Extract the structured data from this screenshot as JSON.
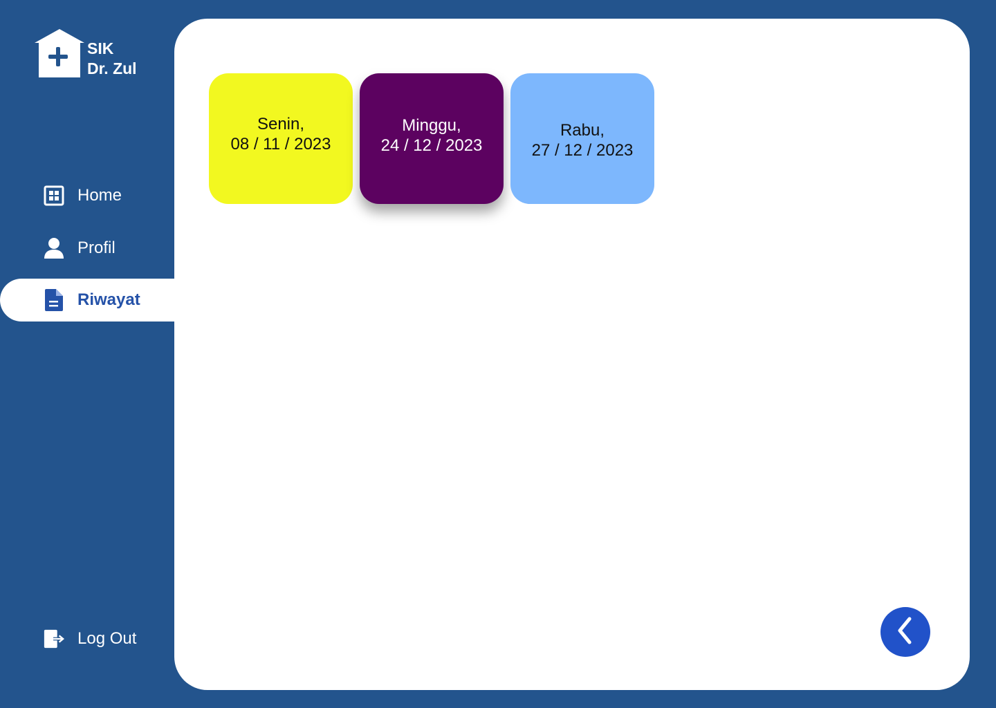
{
  "brand": {
    "line1": "SIK",
    "line2": "Dr. Zul",
    "logo_icon": "medical-house-icon"
  },
  "sidebar": {
    "items": [
      {
        "label": "Home",
        "icon": "grid-icon",
        "active": false
      },
      {
        "label": "Profil",
        "icon": "user-icon",
        "active": false
      },
      {
        "label": "Riwayat",
        "icon": "document-icon",
        "active": true
      }
    ],
    "logout": {
      "label": "Log Out",
      "icon": "logout-icon"
    }
  },
  "main": {
    "cards": [
      {
        "day": "Senin,",
        "date": "08 / 11 / 2023",
        "color": "#f2f820"
      },
      {
        "day": "Minggu,",
        "date": "24 / 12 / 2023",
        "color": "#5c0260"
      },
      {
        "day": "Rabu,",
        "date": "27 / 12 / 2023",
        "color": "#7db7fd"
      }
    ],
    "back_button": {
      "icon": "chevron-left-icon"
    }
  },
  "colors": {
    "background": "#23548d",
    "panel": "#ffffff",
    "accent": "#2552a8",
    "back_button": "#2152c9"
  }
}
